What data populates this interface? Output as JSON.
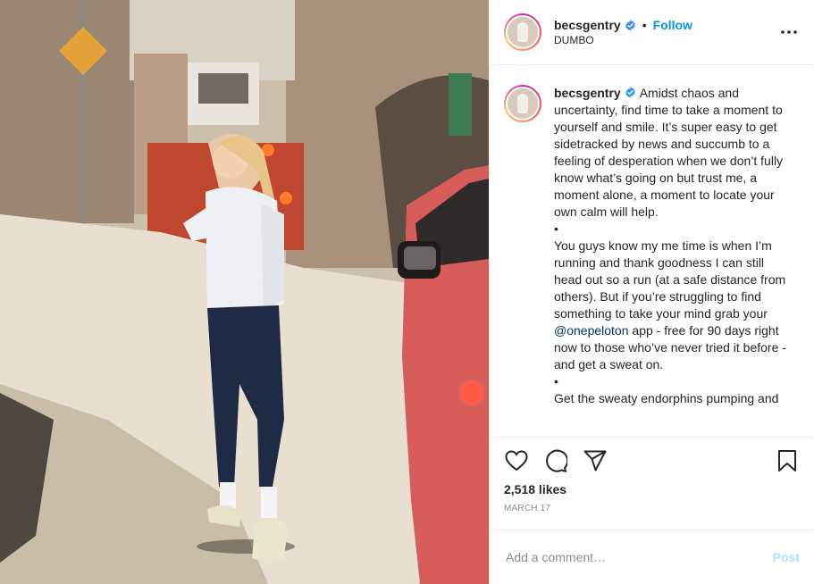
{
  "header": {
    "username": "becsgentry",
    "follow_label": "Follow",
    "dot": "•",
    "location": "DUMBO"
  },
  "caption": {
    "username": "becsgentry",
    "paragraph_1": "Amidst chaos and uncertainty, find time to take a moment to yourself and smile. It’s super easy to get sidetracked by news and succumb to a feeling of desperation when we don’t fully know what’s going on but trust me, a moment alone, a moment to locate your own calm will help.",
    "bullet_1": "•",
    "paragraph_2_before": "You guys know my me time is when I’m running and thank goodness I can still head out so a run (at a safe distance from others). But if you’re struggling to find something to take your mind grab your ",
    "mention": "@onepeloton",
    "paragraph_2_after": " app - free for 90 days right now to those who’ve never tried it before - and get a sweat on.",
    "bullet_2": "•",
    "paragraph_3": "Get the sweaty endorphins pumping and"
  },
  "actions": {
    "icons": [
      "heart-icon",
      "comment-icon",
      "share-icon",
      "bookmark-icon"
    ],
    "likes": "2,518 likes",
    "date": "MARCH 17"
  },
  "comment": {
    "placeholder": "Add a comment…",
    "post_label": "Post"
  },
  "colors": {
    "link": "#0095f6",
    "verified": "#3897f0",
    "post_disabled": "#b2dffc",
    "muted": "#8e8e8e"
  }
}
